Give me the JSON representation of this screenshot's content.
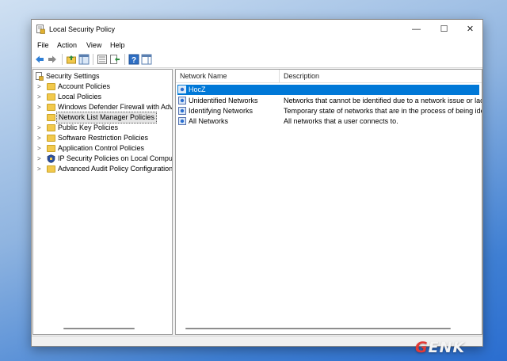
{
  "window": {
    "title": "Local Security Policy",
    "controls": {
      "minimize": "—",
      "maximize": "☐",
      "close": "✕"
    }
  },
  "menu": {
    "items": [
      "File",
      "Action",
      "View",
      "Help"
    ]
  },
  "toolbar": {
    "icons": [
      "back-arrow-icon",
      "forward-arrow-icon",
      "up-folder-icon",
      "show-hide-tree-icon",
      "properties-icon",
      "export-list-icon",
      "help-icon",
      "show-action-pane-icon"
    ]
  },
  "tree": {
    "root": "Security Settings",
    "items": [
      {
        "label": "Account Policies",
        "icon": "folder-lock-icon"
      },
      {
        "label": "Local Policies",
        "icon": "folder-lock-icon"
      },
      {
        "label": "Windows Defender Firewall with Adva",
        "icon": "folder-icon"
      },
      {
        "label": "Network List Manager Policies",
        "icon": "folder-icon",
        "selected": true
      },
      {
        "label": "Public Key Policies",
        "icon": "folder-icon"
      },
      {
        "label": "Software Restriction Policies",
        "icon": "folder-icon"
      },
      {
        "label": "Application Control Policies",
        "icon": "folder-icon"
      },
      {
        "label": "IP Security Policies on Local Compute",
        "icon": "shield-policy-icon"
      },
      {
        "label": "Advanced Audit Policy Configuration",
        "icon": "folder-icon"
      }
    ]
  },
  "list": {
    "columns": [
      "Network Name",
      "Description"
    ],
    "rows": [
      {
        "name": "HocZ",
        "desc": "",
        "selected": true
      },
      {
        "name": "Unidentified Networks",
        "desc": "Networks that cannot be identified due to a network issue or lack o"
      },
      {
        "name": "Identifying Networks",
        "desc": "Temporary state of networks that are in the process of being identi"
      },
      {
        "name": "All Networks",
        "desc": "All networks that a user connects to."
      }
    ]
  },
  "watermark": {
    "text_e": "G",
    "text_rest": "ENK"
  },
  "colors": {
    "selection": "#0078d7",
    "folder": "#f2c94c"
  }
}
